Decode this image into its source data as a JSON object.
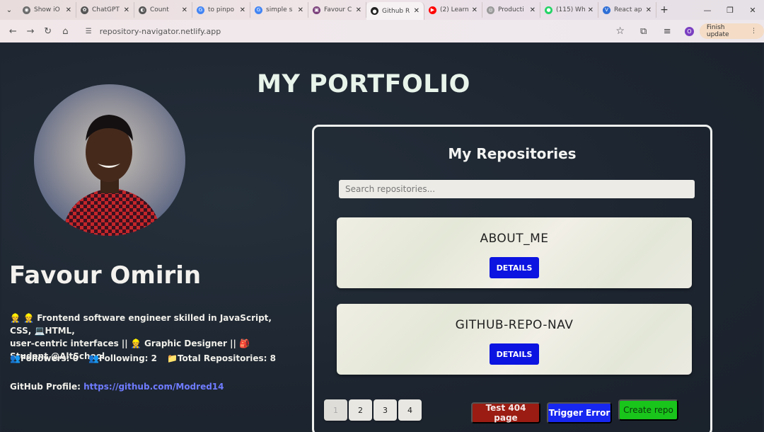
{
  "browser": {
    "tabs": [
      {
        "label": "Show iO",
        "color": "#6b6b6b",
        "glyph": "◉"
      },
      {
        "label": "ChatGPT",
        "color": "#555555",
        "glyph": "✿"
      },
      {
        "label": "Count",
        "color": "#555555",
        "glyph": "◐"
      },
      {
        "label": "to pinpo",
        "color": "#4285f4",
        "glyph": "G"
      },
      {
        "label": "simple s",
        "color": "#4285f4",
        "glyph": "G"
      },
      {
        "label": "Favour C",
        "color": "#7a3f7a",
        "glyph": "▣"
      },
      {
        "label": "Github R",
        "color": "#222222",
        "glyph": "●"
      },
      {
        "label": "(2) Learn",
        "color": "#ff0000",
        "glyph": "▶"
      },
      {
        "label": "Producti",
        "color": "#999999",
        "glyph": "◎"
      },
      {
        "label": "(115) Wh",
        "color": "#25d366",
        "glyph": "●"
      },
      {
        "label": "React ap",
        "color": "#2f6fd6",
        "glyph": "V"
      }
    ],
    "url": "repository-navigator.netlify.app",
    "profile_initial": "O",
    "finish_update": "Finish update"
  },
  "page": {
    "title": "MY PORTFOLIO",
    "name": "Favour Omirin",
    "bio_line1": "👷 👷 Frontend software engineer skilled in JavaScript, CSS, 💻HTML,",
    "bio_line2": "user-centric interfaces || 👷 Graphic Designer || 🎒 Student @AltSchool",
    "followers": "👥Followers: 0",
    "following": "👥Following: 2",
    "total_repos": "📁Total Repositories: 8",
    "github_label": "GitHub Profile: ",
    "github_link": "https://github.com/Modred14"
  },
  "repos": {
    "heading": "My Repositories",
    "search_placeholder": "Search repositories...",
    "items": [
      {
        "name": "ABOUT_ME",
        "button": "DETAILS"
      },
      {
        "name": "GITHUB-REPO-NAV",
        "button": "DETAILS"
      }
    ],
    "pages": [
      "1",
      "2",
      "3",
      "4"
    ],
    "current_page": "1",
    "actions": {
      "test404": "Test 404 page",
      "trigger_error": "Trigger Error",
      "create_repo": "Create repo"
    }
  }
}
